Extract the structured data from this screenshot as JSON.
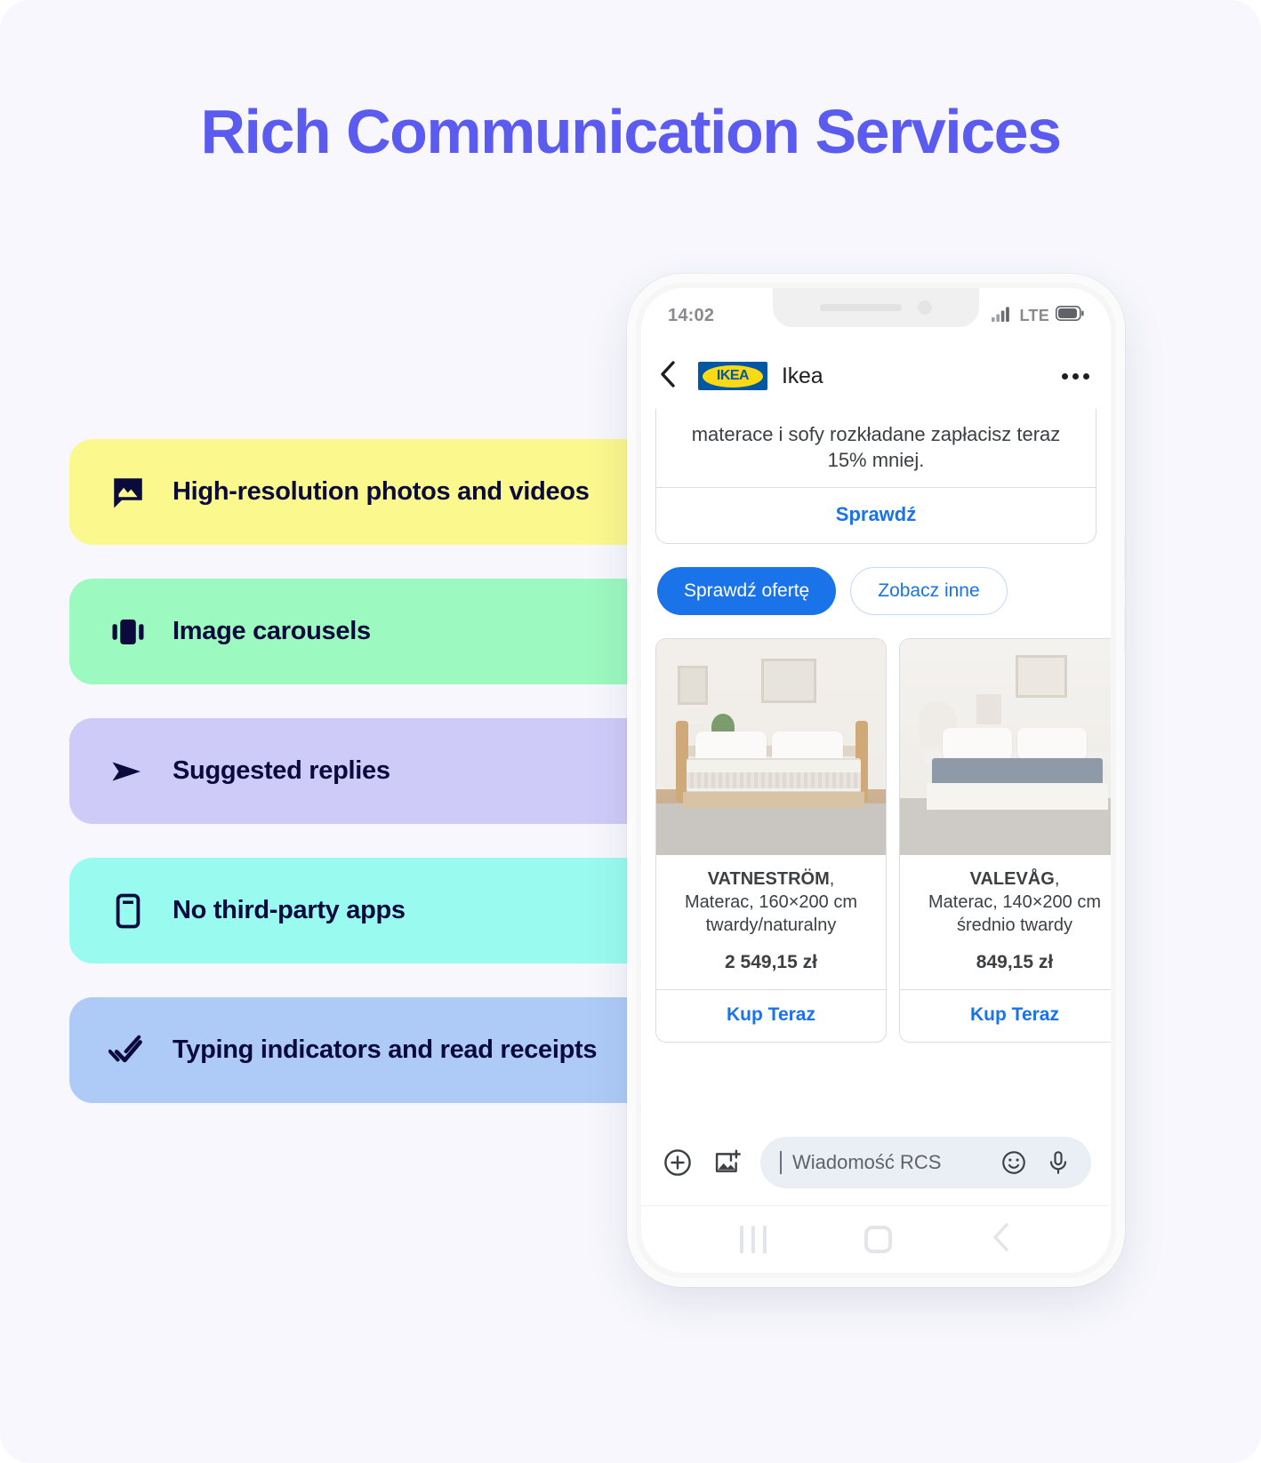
{
  "page": {
    "title": "Rich Communication Services",
    "title_color": "#5b5bf0",
    "background": "#f7f7fd"
  },
  "features": [
    {
      "label": "High-resolution photos and videos",
      "color": "#fbf88e",
      "icon": "photo-message-icon"
    },
    {
      "label": "Image carousels",
      "color": "#9cf9bf",
      "icon": "carousel-icon"
    },
    {
      "label": "Suggested replies",
      "color": "#cfcbf9",
      "icon": "send-arrow-icon"
    },
    {
      "label": "No third-party apps",
      "color": "#99fbf0",
      "icon": "phone-device-icon"
    },
    {
      "label": "Typing indicators and read receipts",
      "color": "#aecbf7",
      "icon": "double-check-icon"
    }
  ],
  "phone": {
    "statusbar": {
      "time": "14:02",
      "network": "LTE",
      "signal_icon": "signal-bars-icon",
      "battery_icon": "battery-icon"
    },
    "header": {
      "back_icon": "back-chevron-icon",
      "logo_text": "IKEA",
      "brand": "Ikea",
      "menu_icon": "more-options-icon",
      "logo_blue": "#0058a3",
      "logo_yellow": "#fbd914"
    },
    "rich_card": {
      "text": "materace i sofy rozkładane zapłacisz teraz 15% mniej.",
      "action": "Sprawdź"
    },
    "chips": [
      {
        "label": "Sprawdź ofertę",
        "style": "primary"
      },
      {
        "label": "Zobacz inne",
        "style": "ghost"
      }
    ],
    "carousel": [
      {
        "name": "VATNESTRÖM",
        "name_suffix": ",",
        "desc": "Materac, 160×200 cm twardy/naturalny",
        "price": "2 549,15 zł",
        "button": "Kup Teraz"
      },
      {
        "name": "VALEVÅG",
        "name_suffix": ",",
        "desc": "Materac, 140×200 cm średnio twardy",
        "price": "849,15 zł",
        "button": "Kup Teraz"
      }
    ],
    "input": {
      "placeholder": "Wiadomość RCS",
      "plus_icon": "add-plus-icon",
      "image_icon": "add-image-icon",
      "emoji_icon": "emoji-icon",
      "mic_icon": "microphone-icon"
    },
    "navbar": {
      "recents_icon": "recents-icon",
      "home_icon": "home-icon",
      "back_icon": "nav-back-icon"
    },
    "accent_blue": "#1a73e8"
  }
}
